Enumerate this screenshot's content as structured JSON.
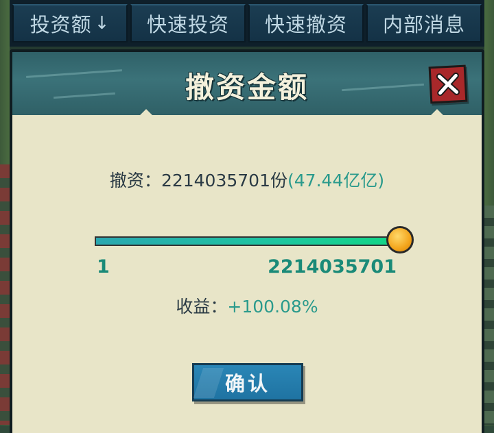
{
  "tabs": [
    {
      "label": "投资额",
      "arrow": "↓"
    },
    {
      "label": "快速投资"
    },
    {
      "label": "快速撤资"
    },
    {
      "label": "内部消息"
    }
  ],
  "dialog": {
    "title": "撤资金额",
    "close_icon": "close-x-icon",
    "withdraw": {
      "label": "撤资：",
      "shares": "2214035701份",
      "amount": "(47.44亿亿)"
    },
    "slider": {
      "min_label": "1",
      "max_label": "2214035701",
      "min": 1,
      "max": 2214035701,
      "value": 2214035701
    },
    "gain": {
      "label": "收益：",
      "value": "+100.08%"
    },
    "confirm_label": "确认"
  },
  "colors": {
    "header": "#2f6168",
    "panel": "#e8e5c8",
    "accent_teal": "#2a9a8c",
    "close_red": "#a8282a",
    "confirm_blue": "#2a86b6",
    "thumb_orange": "#f3a51c"
  }
}
